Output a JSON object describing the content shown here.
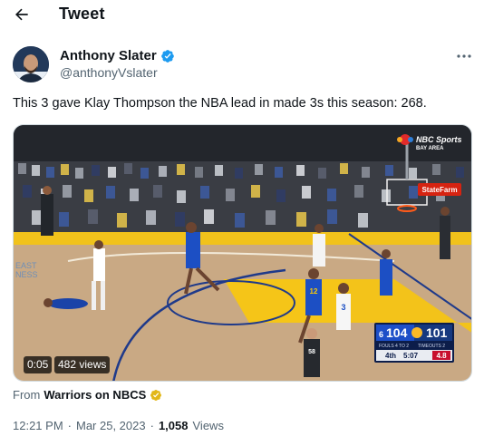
{
  "header": {
    "title": "Tweet",
    "back_icon": "arrow-left-icon"
  },
  "author": {
    "display_name": "Anthony Slater",
    "handle": "@anthonyVslater",
    "verified_color": "#1d9bf0"
  },
  "tweet": {
    "text": "This 3 gave Klay Thompson the NBA lead in made 3s this season: 268."
  },
  "video": {
    "time": "0:05",
    "views": "482 views",
    "broadcast": {
      "network": "NBC Sports",
      "region": "BAY AREA",
      "home_seed": "6",
      "home_score": "104",
      "away_score": "101",
      "home_fouls": "FOULS 4",
      "home_timeouts": "TO 2",
      "away_timeouts": "TIMEOUTS 2",
      "quarter": "4th",
      "clock": "5:07",
      "shot_clock": "4.8",
      "court_sign": "StateFarm",
      "baseline_text_top": "EAST",
      "baseline_text_bottom": "NESS",
      "jersey_defender": "12",
      "jersey_shooter": "3",
      "jersey_referee": "58"
    }
  },
  "source": {
    "prefix": "From",
    "name": "Warriors on NBCS",
    "badge_color": "#e2b719"
  },
  "meta": {
    "time": "12:21 PM",
    "date": "Mar 25, 2023",
    "separator": "·",
    "views_count": "1,058",
    "views_label": "Views"
  }
}
